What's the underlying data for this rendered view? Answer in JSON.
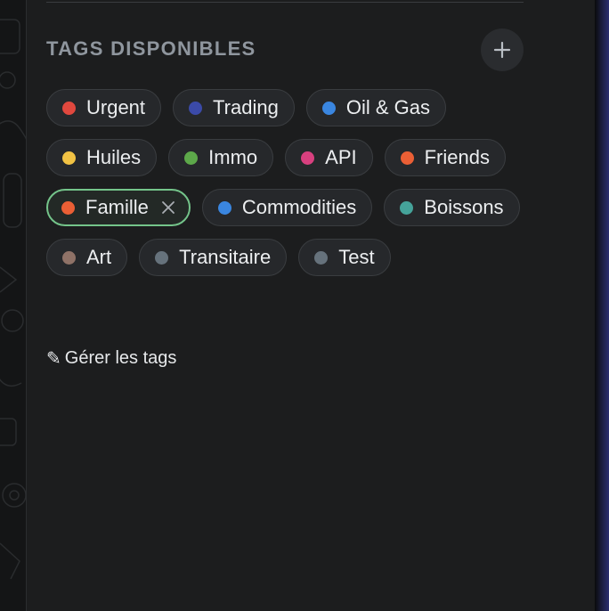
{
  "section": {
    "title": "TAGS DISPONIBLES",
    "add_icon": "plus-icon"
  },
  "tags": [
    {
      "label": "Urgent",
      "color": "#e0483e",
      "selected": false
    },
    {
      "label": "Trading",
      "color": "#3b4aa8",
      "selected": false
    },
    {
      "label": "Oil & Gas",
      "color": "#3a86e0",
      "selected": false
    },
    {
      "label": "Huiles",
      "color": "#f1c244",
      "selected": false
    },
    {
      "label": "Immo",
      "color": "#5da84a",
      "selected": false
    },
    {
      "label": "API",
      "color": "#d8407f",
      "selected": false
    },
    {
      "label": "Friends",
      "color": "#ea5f35",
      "selected": false
    },
    {
      "label": "Famille",
      "color": "#ea5f35",
      "selected": true
    },
    {
      "label": "Commodities",
      "color": "#3a86e0",
      "selected": false
    },
    {
      "label": "Boissons",
      "color": "#45a39a",
      "selected": false
    },
    {
      "label": "Art",
      "color": "#8f7267",
      "selected": false
    },
    {
      "label": "Transitaire",
      "color": "#66727c",
      "selected": false
    },
    {
      "label": "Test",
      "color": "#66727c",
      "selected": false
    }
  ],
  "manage": {
    "icon": "pencil-icon",
    "icon_glyph": "✎",
    "label": "Gérer les tags"
  },
  "colors": {
    "panel_bg": "#1c1d1e",
    "tag_bg": "#26282b",
    "selected_border": "#74c48a",
    "title": "#8f969e"
  }
}
